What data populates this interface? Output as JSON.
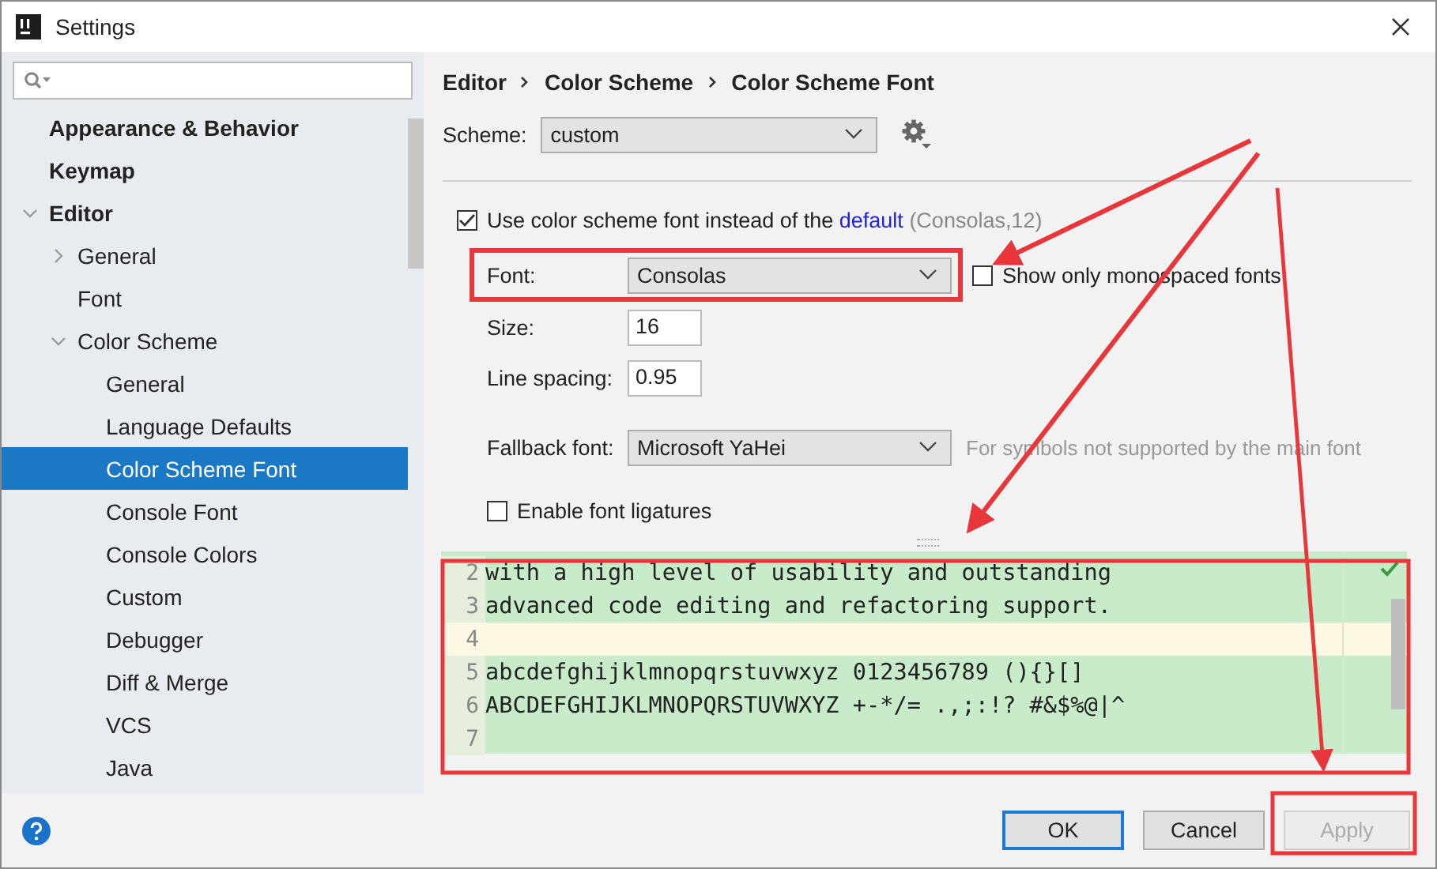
{
  "window": {
    "title": "Settings"
  },
  "sidebar": {
    "items": [
      {
        "label": "Appearance & Behavior",
        "selected": false
      },
      {
        "label": "Keymap",
        "selected": false
      },
      {
        "label": "Editor",
        "selected": false,
        "expanded": true,
        "children": [
          {
            "label": "General",
            "selected": false,
            "expanded": false
          },
          {
            "label": "Font",
            "selected": false
          },
          {
            "label": "Color Scheme",
            "selected": false,
            "expanded": true,
            "children": [
              {
                "label": "General",
                "selected": false
              },
              {
                "label": "Language Defaults",
                "selected": false
              },
              {
                "label": "Color Scheme Font",
                "selected": true
              },
              {
                "label": "Console Font",
                "selected": false
              },
              {
                "label": "Console Colors",
                "selected": false
              },
              {
                "label": "Custom",
                "selected": false
              },
              {
                "label": "Debugger",
                "selected": false
              },
              {
                "label": "Diff & Merge",
                "selected": false
              },
              {
                "label": "VCS",
                "selected": false
              },
              {
                "label": "Java",
                "selected": false
              }
            ]
          }
        ]
      }
    ]
  },
  "breadcrumb": [
    "Editor",
    "Color Scheme",
    "Color Scheme Font"
  ],
  "scheme": {
    "label": "Scheme:",
    "value": "custom"
  },
  "use_scheme_font": {
    "checked": true,
    "text": "Use color scheme font instead of the",
    "link": "default",
    "note": "(Consolas,12)"
  },
  "font": {
    "label": "Font:",
    "value": "Consolas"
  },
  "monospaced_only": {
    "label": "Show only monospaced fonts",
    "checked": false
  },
  "size": {
    "label": "Size:",
    "value": "16"
  },
  "line_spacing": {
    "label": "Line spacing:",
    "value": "0.95"
  },
  "fallback_font": {
    "label": "Fallback font:",
    "value": "Microsoft YaHei",
    "hint": "For symbols not supported by the main font"
  },
  "ligatures": {
    "label": "Enable font ligatures",
    "checked": false
  },
  "preview": {
    "lines": [
      {
        "number": "2",
        "text": "with a high level of usability and outstanding",
        "current": false
      },
      {
        "number": "3",
        "text": "advanced code editing and refactoring support.",
        "current": false
      },
      {
        "number": "4",
        "current": true
      },
      {
        "number": "5",
        "text": "abcdefghijklmnopqrstuvwxyz 0123456789 (){}[]",
        "current": false
      },
      {
        "number": "6",
        "text": "ABCDEFGHIJKLMNOPQRSTUVWXYZ +-*/= .,;:!? #&$%@|^",
        "current": false
      },
      {
        "number": "7",
        "current": false
      }
    ]
  },
  "buttons": [
    {
      "label": "OK",
      "default": true,
      "disabled": false
    },
    {
      "label": "Cancel",
      "default": false,
      "disabled": false
    },
    {
      "label": "Apply",
      "default": false,
      "disabled": true
    }
  ]
}
